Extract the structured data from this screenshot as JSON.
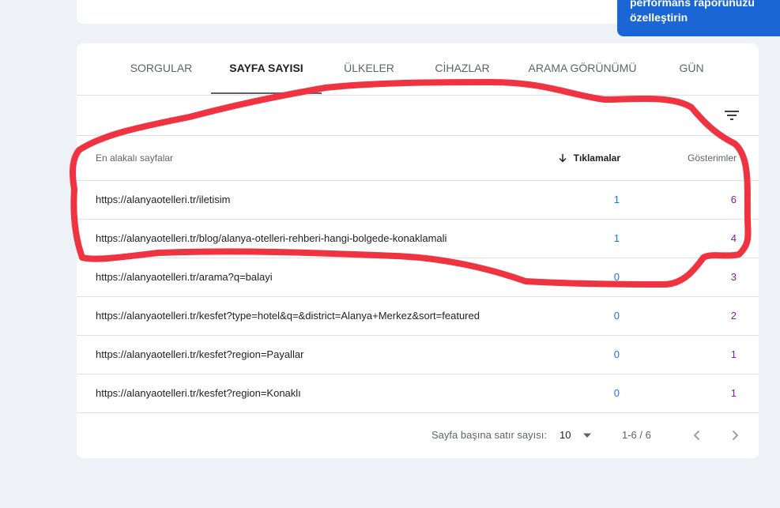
{
  "toast": {
    "line1": "performans raporunuzu",
    "line2": "özelleştirin"
  },
  "tabs": [
    {
      "label": "SORGULAR",
      "active": false
    },
    {
      "label": "SAYFA SAYISI",
      "active": true
    },
    {
      "label": "ÜLKELER",
      "active": false
    },
    {
      "label": "CİHAZLAR",
      "active": false
    },
    {
      "label": "ARAMA GÖRÜNÜMÜ",
      "active": false
    },
    {
      "label": "GÜN",
      "active": false
    }
  ],
  "table": {
    "headers": {
      "page": "En alakalı sayfalar",
      "clicks": "Tıklamalar",
      "impressions": "Gösterimler"
    },
    "rows": [
      {
        "url": "https://alanyaotelleri.tr/iletisim",
        "clicks": "1",
        "impressions": "6"
      },
      {
        "url": "https://alanyaotelleri.tr/blog/alanya-otelleri-rehberi-hangi-bolgede-konaklamali",
        "clicks": "1",
        "impressions": "4"
      },
      {
        "url": "https://alanyaotelleri.tr/arama?q=balayi",
        "clicks": "0",
        "impressions": "3"
      },
      {
        "url": "https://alanyaotelleri.tr/kesfet?type=hotel&q=&district=Alanya+Merkez&sort=featured",
        "clicks": "0",
        "impressions": "2"
      },
      {
        "url": "https://alanyaotelleri.tr/kesfet?region=Payallar",
        "clicks": "0",
        "impressions": "1"
      },
      {
        "url": "https://alanyaotelleri.tr/kesfet?region=Konaklı",
        "clicks": "0",
        "impressions": "1"
      }
    ]
  },
  "pager": {
    "rows_per_page_label": "Sayfa başına satır sayısı:",
    "rows_per_page_value": "10",
    "range": "1-6 / 6"
  },
  "icons": {
    "filter": "filter-icon",
    "sort": "arrow-down-icon",
    "dropdown": "caret-down-icon",
    "prev": "chevron-left-icon",
    "next": "chevron-right-icon"
  },
  "colors": {
    "clicks": "#1a73e8",
    "impressions": "#7b1fa2",
    "toast": "#1a66d6",
    "annotation": "#ef3340"
  }
}
